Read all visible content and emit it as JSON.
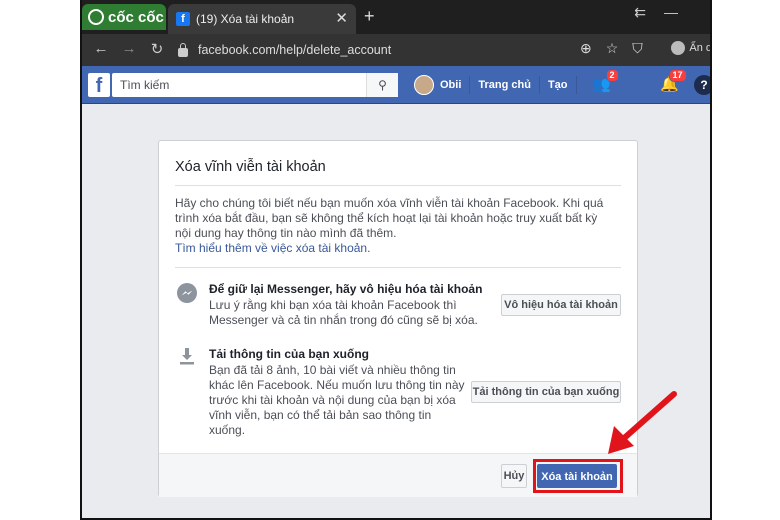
{
  "browser": {
    "brand": "cốc cốc",
    "tab_title": "(19) Xóa tài khoản",
    "tab_favicon": "f",
    "url": "facebook.com/help/delete_account",
    "profile_label": "Ẩn d"
  },
  "fb": {
    "search_placeholder": "Tìm kiếm",
    "user_name": "Obii",
    "home": "Trang chủ",
    "create": "Tạo",
    "friend_badge": "2",
    "notif_badge": "17"
  },
  "dialog": {
    "title": "Xóa vĩnh viễn tài khoản",
    "intro": "Hãy cho chúng tôi biết nếu bạn muốn xóa vĩnh viễn tài khoản Facebook. Khi quá trình xóa bắt đầu, bạn sẽ không thể kích hoạt lại tài khoản hoặc truy xuất bất kỳ nội dung hay thông tin nào mình đã thêm.",
    "learn_more": "Tìm hiểu thêm về việc xóa tài khoản.",
    "messenger": {
      "title": "Để giữ lại Messenger, hãy vô hiệu hóa tài khoản",
      "body_1": "Lưu ý rằng khi bạn xóa tài khoản Facebook thì",
      "body_2": "Messenger và cả tin nhắn trong đó cũng sẽ bị xóa.",
      "button": "Vô hiệu hóa tài khoản"
    },
    "download": {
      "title": "Tải thông tin của bạn xuống",
      "body_1": "Bạn đã tải 8 ảnh, 10 bài viết và nhiều thông tin",
      "body_2": "khác lên Facebook. Nếu muốn lưu thông tin này",
      "body_3": "trước khi tài khoản và nội dung của bạn bị xóa",
      "body_4": "vĩnh viễn, bạn có thể tải bản sao thông tin",
      "body_5": "xuống.",
      "button": "Tải thông tin của bạn xuống"
    },
    "cancel": "Hủy",
    "delete": "Xóa tài khoản"
  },
  "colors": {
    "fb_blue": "#4267b2",
    "highlight": "#e1141b",
    "brand_green": "#2e7d32"
  }
}
